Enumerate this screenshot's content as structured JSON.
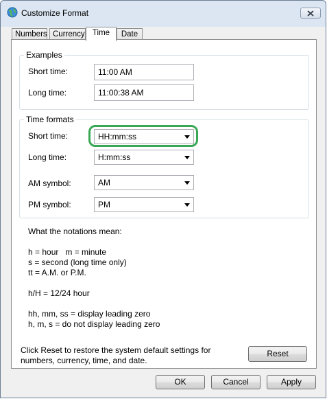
{
  "window": {
    "title": "Customize Format",
    "icon": "globe-icon",
    "close_icon": "close-icon"
  },
  "tabs": [
    {
      "label": "Numbers",
      "active": false
    },
    {
      "label": "Currency",
      "active": false
    },
    {
      "label": "Time",
      "active": true
    },
    {
      "label": "Date",
      "active": false
    }
  ],
  "examples": {
    "title": "Examples",
    "short_label": "Short time:",
    "short_value": "11:00 AM",
    "long_label": "Long time:",
    "long_value": "11:00:38 AM"
  },
  "formats": {
    "title": "Time formats",
    "short_label": "Short time:",
    "short_value": "HH:mm:ss",
    "long_label": "Long time:",
    "long_value": "H:mm:ss",
    "am_label": "AM symbol:",
    "am_value": "AM",
    "pm_label": "PM symbol:",
    "pm_value": "PM"
  },
  "notations": {
    "heading": "What the notations mean:",
    "line1": "h = hour   m = minute",
    "line2": "s = second (long time only)",
    "line3": "tt = A.M. or P.M.",
    "line4": "h/H = 12/24 hour",
    "line5": "hh, mm, ss = display leading zero",
    "line6": "h, m, s = do not display leading zero"
  },
  "reset": {
    "text_line1": "Click Reset to restore the system default settings for",
    "text_line2": "numbers, currency, time, and date.",
    "button": "Reset"
  },
  "buttons": {
    "ok": "OK",
    "cancel": "Cancel",
    "apply": "Apply"
  },
  "colors": {
    "highlight": "#3aa757",
    "title_bar": "#dbe6f2"
  }
}
